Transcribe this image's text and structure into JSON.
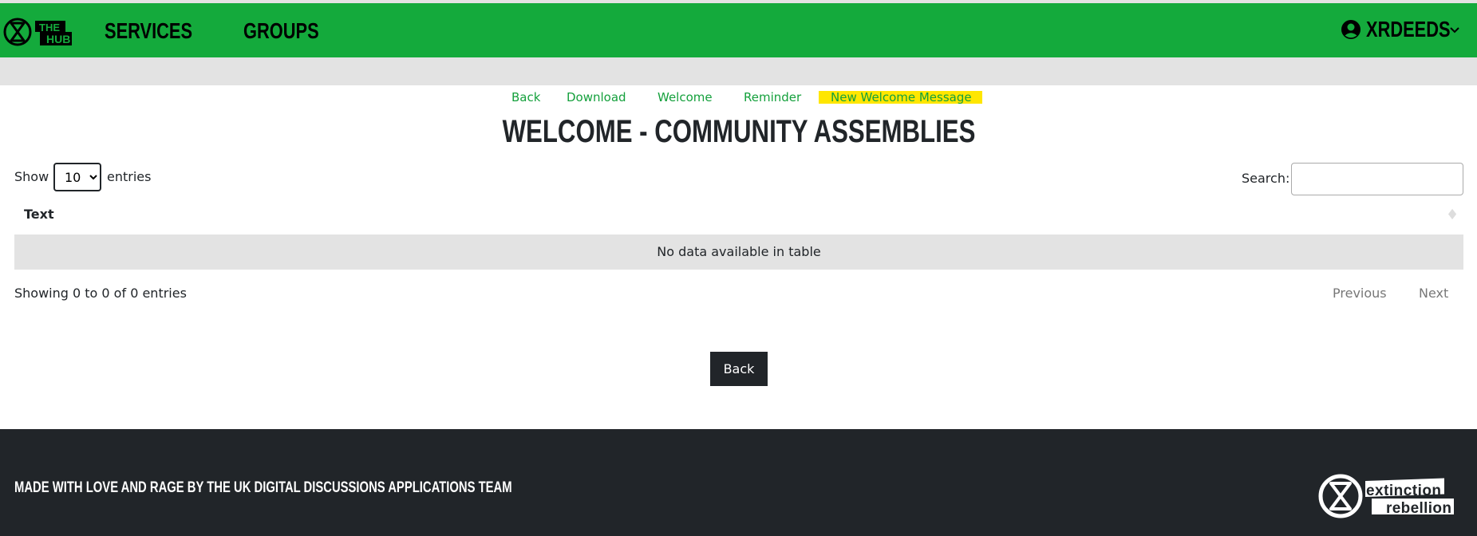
{
  "nav": {
    "logo_text": "THE HUB",
    "items": [
      {
        "label": "SERVICES"
      },
      {
        "label": "GROUPS"
      }
    ],
    "user": {
      "name": "XRDEEDS",
      "icon": "user-circle-icon"
    },
    "brand_color": "#14aa3c"
  },
  "links": [
    {
      "label": "Back"
    },
    {
      "label": "Download"
    },
    {
      "label": "Welcome"
    },
    {
      "label": "Reminder"
    },
    {
      "label": "New Welcome Message",
      "highlighted": true
    }
  ],
  "page_title": "WELCOME - COMMUNITY ASSEMBLIES",
  "table": {
    "show_label": "Show",
    "page_size": "10",
    "entries_label": "entries",
    "search_label": "Search:",
    "search_value": "",
    "columns": [
      {
        "label": "Text"
      }
    ],
    "empty_message": "No data available in table",
    "info": "Showing 0 to 0 of 0 entries",
    "previous": "Previous",
    "next": "Next"
  },
  "back_button": "Back",
  "footer": {
    "text": "MADE WITH LOVE AND RAGE BY THE UK DIGITAL DISCUSSIONS APPLICATIONS TEAM",
    "logo_text": "extinction rebellion"
  }
}
